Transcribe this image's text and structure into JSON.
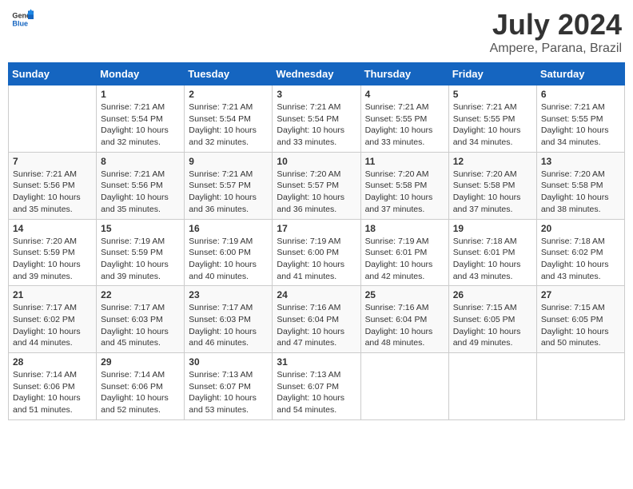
{
  "header": {
    "logo_general": "General",
    "logo_blue": "Blue",
    "month": "July 2024",
    "location": "Ampere, Parana, Brazil"
  },
  "weekdays": [
    "Sunday",
    "Monday",
    "Tuesday",
    "Wednesday",
    "Thursday",
    "Friday",
    "Saturday"
  ],
  "weeks": [
    [
      {
        "day": "",
        "info": ""
      },
      {
        "day": "1",
        "info": "Sunrise: 7:21 AM\nSunset: 5:54 PM\nDaylight: 10 hours\nand 32 minutes."
      },
      {
        "day": "2",
        "info": "Sunrise: 7:21 AM\nSunset: 5:54 PM\nDaylight: 10 hours\nand 32 minutes."
      },
      {
        "day": "3",
        "info": "Sunrise: 7:21 AM\nSunset: 5:54 PM\nDaylight: 10 hours\nand 33 minutes."
      },
      {
        "day": "4",
        "info": "Sunrise: 7:21 AM\nSunset: 5:55 PM\nDaylight: 10 hours\nand 33 minutes."
      },
      {
        "day": "5",
        "info": "Sunrise: 7:21 AM\nSunset: 5:55 PM\nDaylight: 10 hours\nand 34 minutes."
      },
      {
        "day": "6",
        "info": "Sunrise: 7:21 AM\nSunset: 5:55 PM\nDaylight: 10 hours\nand 34 minutes."
      }
    ],
    [
      {
        "day": "7",
        "info": "Sunrise: 7:21 AM\nSunset: 5:56 PM\nDaylight: 10 hours\nand 35 minutes."
      },
      {
        "day": "8",
        "info": "Sunrise: 7:21 AM\nSunset: 5:56 PM\nDaylight: 10 hours\nand 35 minutes."
      },
      {
        "day": "9",
        "info": "Sunrise: 7:21 AM\nSunset: 5:57 PM\nDaylight: 10 hours\nand 36 minutes."
      },
      {
        "day": "10",
        "info": "Sunrise: 7:20 AM\nSunset: 5:57 PM\nDaylight: 10 hours\nand 36 minutes."
      },
      {
        "day": "11",
        "info": "Sunrise: 7:20 AM\nSunset: 5:58 PM\nDaylight: 10 hours\nand 37 minutes."
      },
      {
        "day": "12",
        "info": "Sunrise: 7:20 AM\nSunset: 5:58 PM\nDaylight: 10 hours\nand 37 minutes."
      },
      {
        "day": "13",
        "info": "Sunrise: 7:20 AM\nSunset: 5:58 PM\nDaylight: 10 hours\nand 38 minutes."
      }
    ],
    [
      {
        "day": "14",
        "info": "Sunrise: 7:20 AM\nSunset: 5:59 PM\nDaylight: 10 hours\nand 39 minutes."
      },
      {
        "day": "15",
        "info": "Sunrise: 7:19 AM\nSunset: 5:59 PM\nDaylight: 10 hours\nand 39 minutes."
      },
      {
        "day": "16",
        "info": "Sunrise: 7:19 AM\nSunset: 6:00 PM\nDaylight: 10 hours\nand 40 minutes."
      },
      {
        "day": "17",
        "info": "Sunrise: 7:19 AM\nSunset: 6:00 PM\nDaylight: 10 hours\nand 41 minutes."
      },
      {
        "day": "18",
        "info": "Sunrise: 7:19 AM\nSunset: 6:01 PM\nDaylight: 10 hours\nand 42 minutes."
      },
      {
        "day": "19",
        "info": "Sunrise: 7:18 AM\nSunset: 6:01 PM\nDaylight: 10 hours\nand 43 minutes."
      },
      {
        "day": "20",
        "info": "Sunrise: 7:18 AM\nSunset: 6:02 PM\nDaylight: 10 hours\nand 43 minutes."
      }
    ],
    [
      {
        "day": "21",
        "info": "Sunrise: 7:17 AM\nSunset: 6:02 PM\nDaylight: 10 hours\nand 44 minutes."
      },
      {
        "day": "22",
        "info": "Sunrise: 7:17 AM\nSunset: 6:03 PM\nDaylight: 10 hours\nand 45 minutes."
      },
      {
        "day": "23",
        "info": "Sunrise: 7:17 AM\nSunset: 6:03 PM\nDaylight: 10 hours\nand 46 minutes."
      },
      {
        "day": "24",
        "info": "Sunrise: 7:16 AM\nSunset: 6:04 PM\nDaylight: 10 hours\nand 47 minutes."
      },
      {
        "day": "25",
        "info": "Sunrise: 7:16 AM\nSunset: 6:04 PM\nDaylight: 10 hours\nand 48 minutes."
      },
      {
        "day": "26",
        "info": "Sunrise: 7:15 AM\nSunset: 6:05 PM\nDaylight: 10 hours\nand 49 minutes."
      },
      {
        "day": "27",
        "info": "Sunrise: 7:15 AM\nSunset: 6:05 PM\nDaylight: 10 hours\nand 50 minutes."
      }
    ],
    [
      {
        "day": "28",
        "info": "Sunrise: 7:14 AM\nSunset: 6:06 PM\nDaylight: 10 hours\nand 51 minutes."
      },
      {
        "day": "29",
        "info": "Sunrise: 7:14 AM\nSunset: 6:06 PM\nDaylight: 10 hours\nand 52 minutes."
      },
      {
        "day": "30",
        "info": "Sunrise: 7:13 AM\nSunset: 6:07 PM\nDaylight: 10 hours\nand 53 minutes."
      },
      {
        "day": "31",
        "info": "Sunrise: 7:13 AM\nSunset: 6:07 PM\nDaylight: 10 hours\nand 54 minutes."
      },
      {
        "day": "",
        "info": ""
      },
      {
        "day": "",
        "info": ""
      },
      {
        "day": "",
        "info": ""
      }
    ]
  ]
}
